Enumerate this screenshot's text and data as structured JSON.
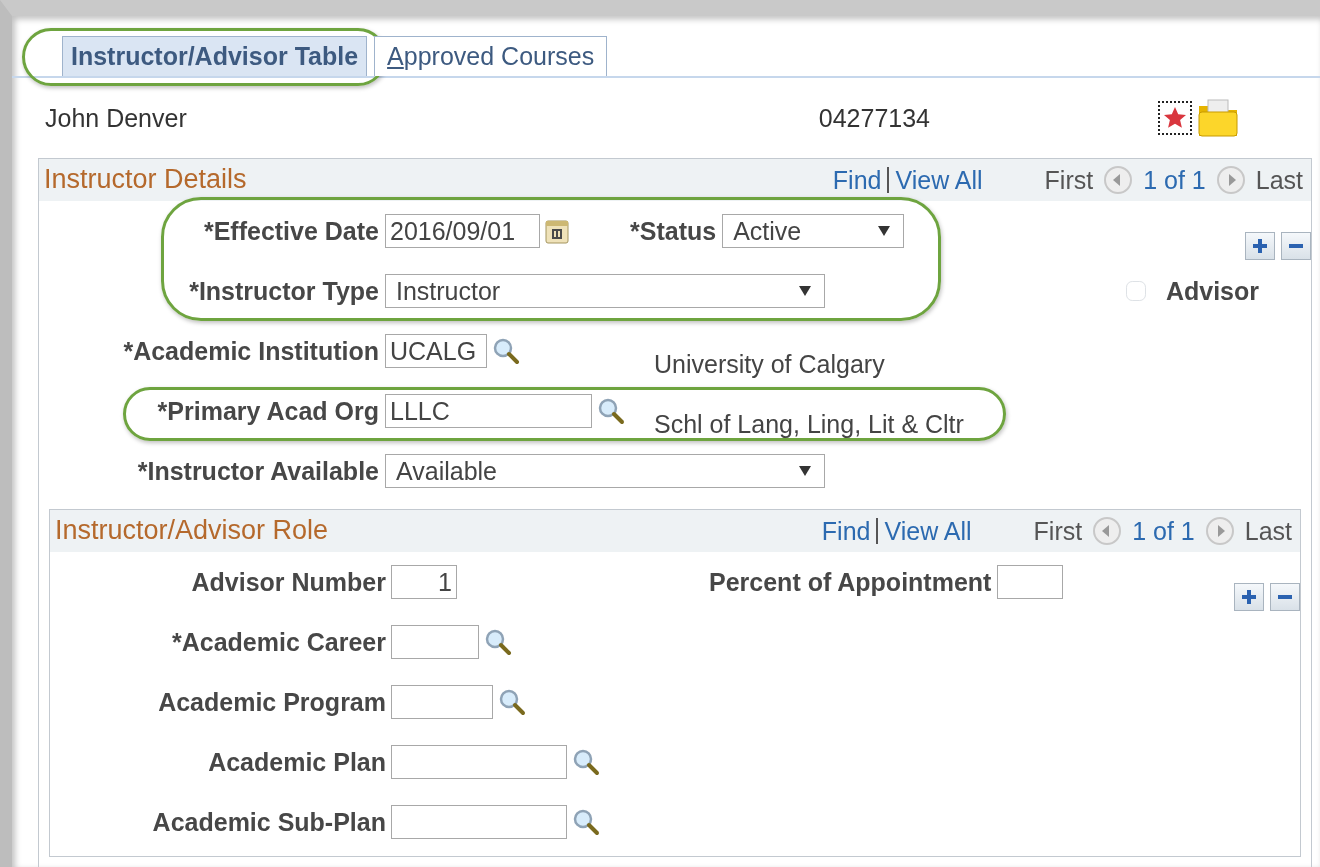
{
  "tabs": [
    {
      "label": "Instructor/Advisor Table",
      "selected": true,
      "circled": true,
      "mnemonic_underlined": false
    },
    {
      "label": "Approved Courses",
      "selected": false,
      "circled": false,
      "mnemonic_underlined": true
    }
  ],
  "header": {
    "name": "John Denver",
    "id": "04277134"
  },
  "details": {
    "title": "Instructor Details",
    "nav": {
      "find": "Find",
      "view_all": "View All",
      "first": "First",
      "count": "1 of 1",
      "last": "Last"
    },
    "rows": [
      {
        "circled": true,
        "fields": [
          {
            "kind": "date",
            "label": "*Effective Date",
            "value": "2016/09/01"
          },
          {
            "kind": "select",
            "label": "*Status",
            "value": "Active"
          }
        ],
        "side": {
          "kind": "add_remove"
        }
      },
      {
        "circled": true,
        "fields": [
          {
            "kind": "select",
            "label": "*Instructor Type",
            "value": "Instructor"
          }
        ],
        "side": {
          "kind": "checkbox",
          "label": "Advisor",
          "checked": false
        }
      },
      {
        "circled": false,
        "fields": [
          {
            "kind": "lookup",
            "label": "*Academic Institution",
            "value": "UCALG",
            "description": "University of Calgary"
          }
        ]
      },
      {
        "circled": true,
        "fields": [
          {
            "kind": "lookup",
            "label": "*Primary Acad Org",
            "value": "LLLC",
            "description": "Schl of Lang, Ling, Lit & Cltr"
          }
        ]
      },
      {
        "circled": false,
        "fields": [
          {
            "kind": "select",
            "label": "*Instructor Available",
            "value": "Available"
          }
        ]
      }
    ],
    "role": {
      "title": "Instructor/Advisor Role",
      "nav": {
        "find": "Find",
        "view_all": "View All",
        "first": "First",
        "count": "1 of 1",
        "last": "Last"
      },
      "rows": [
        {
          "circled": false,
          "fields": [
            {
              "kind": "number",
              "label": "Advisor Number",
              "value": "1"
            },
            {
              "kind": "number",
              "label": "Percent of Appointment"
            }
          ],
          "side": {
            "kind": "add_remove"
          }
        },
        {
          "circled": false,
          "fields": [
            {
              "kind": "lookup",
              "label": "*Academic Career"
            }
          ]
        },
        {
          "circled": false,
          "fields": [
            {
              "kind": "lookup",
              "label": "Academic Program"
            }
          ]
        },
        {
          "circled": false,
          "fields": [
            {
              "kind": "lookup",
              "label": "Academic Plan"
            }
          ]
        },
        {
          "circled": false,
          "fields": [
            {
              "kind": "lookup",
              "label": "Academic Sub-Plan"
            }
          ]
        }
      ]
    }
  }
}
